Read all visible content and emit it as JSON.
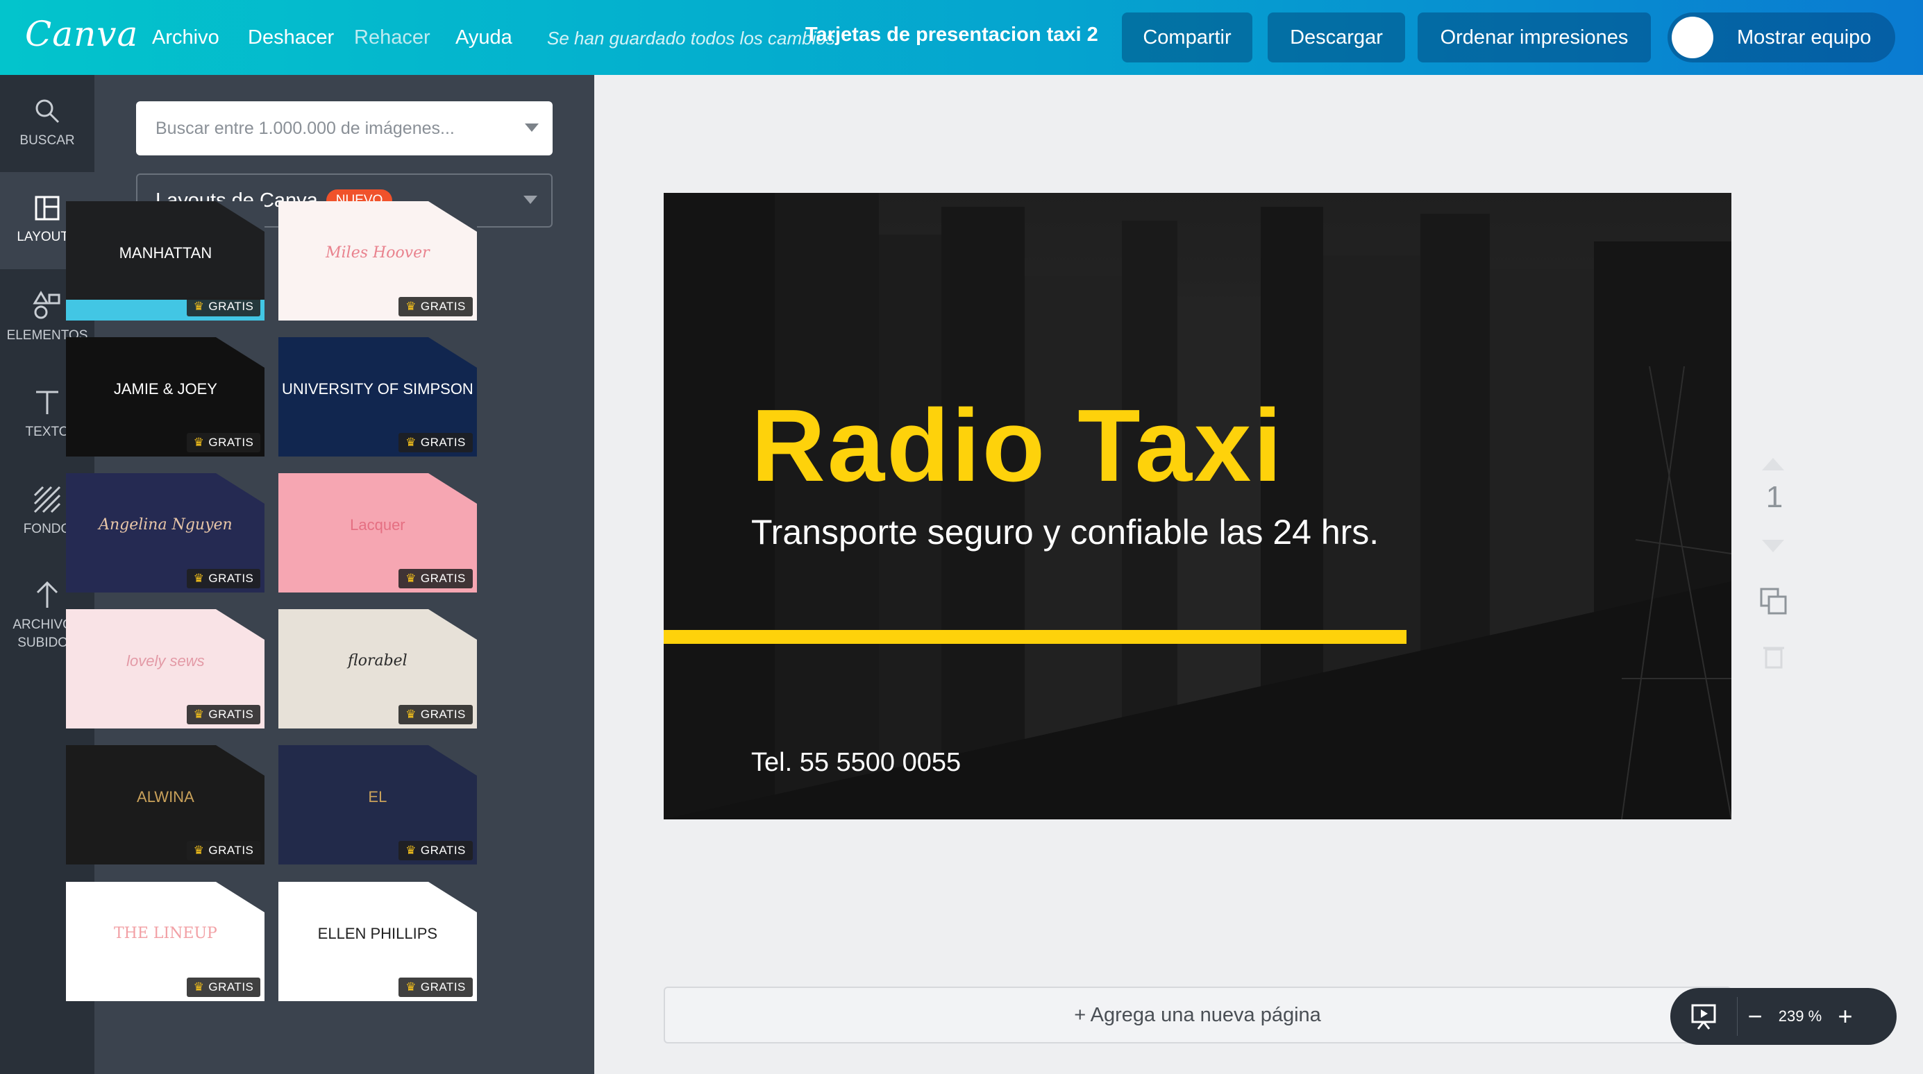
{
  "topbar": {
    "logo": "Canva",
    "menu": [
      "Archivo",
      "Deshacer",
      "Rehacer",
      "Ayuda"
    ],
    "saved_message": "Se han guardado todos los cambios",
    "doc_title": "Tarjetas de presentacion taxi 2",
    "share_label": "Compartir",
    "download_label": "Descargar",
    "order_label": "Ordenar impresiones",
    "team_label": "Mostrar equipo"
  },
  "rail": {
    "items": [
      {
        "label": "BUSCAR",
        "icon": "search-icon"
      },
      {
        "label": "LAYOUTS",
        "icon": "layouts-icon",
        "active": true
      },
      {
        "label": "ELEMENTOS",
        "icon": "elements-icon"
      },
      {
        "label": "TEXTO",
        "icon": "text-icon"
      },
      {
        "label": "FONDO",
        "icon": "background-icon"
      },
      {
        "label": "ARCHIVOS SUBIDOS",
        "icon": "upload-icon"
      }
    ]
  },
  "panel": {
    "search_placeholder": "Buscar entre 1.000.000 de imágenes...",
    "layouts_label": "Layouts de Canva",
    "new_badge": "NUEVO",
    "free_label": "GRATIS",
    "templates": [
      {
        "name": "MANHATTAN",
        "bg": "#1e1f21",
        "fg": "#ffffff"
      },
      {
        "name": "Miles Hoover",
        "bg": "#fbf3f2",
        "fg": "#e9828e"
      },
      {
        "name": "JAMIE & JOEY",
        "bg": "#111111",
        "fg": "#ffffff"
      },
      {
        "name": "UNIVERSITY OF SIMPSON",
        "bg": "#11264f",
        "fg": "#ffffff"
      },
      {
        "name": "Angelina Nguyen",
        "bg": "#252a52",
        "fg": "#e8c6a8"
      },
      {
        "name": "Lacquer",
        "bg": "#f6a6b2",
        "fg": "#e56f82"
      },
      {
        "name": "lovely sews",
        "bg": "#f9e3e6",
        "fg": "#e39aa6"
      },
      {
        "name": "florabel",
        "bg": "#e7e1d8",
        "fg": "#2a2a2a"
      },
      {
        "name": "ALWINA",
        "bg": "#1b1b1b",
        "fg": "#c9a15a"
      },
      {
        "name": "EL",
        "bg": "#222a4a",
        "fg": "#c9a15a"
      },
      {
        "name": "THE LINEUP",
        "bg": "#ffffff",
        "fg": "#f2a0a5"
      },
      {
        "name": "ELLEN PHILLIPS",
        "bg": "#ffffff",
        "fg": "#222222"
      }
    ]
  },
  "card": {
    "title": "Radio Taxi",
    "subtitle": "Transporte seguro y confiable las 24 hrs.",
    "phone": "Tel. 55 5500 0055",
    "accent": "#fed20b"
  },
  "page_number": "1",
  "add_page_label": "+ Agrega una nueva página",
  "zoom": "239 %",
  "zoom_minus": "−",
  "zoom_plus": "+"
}
